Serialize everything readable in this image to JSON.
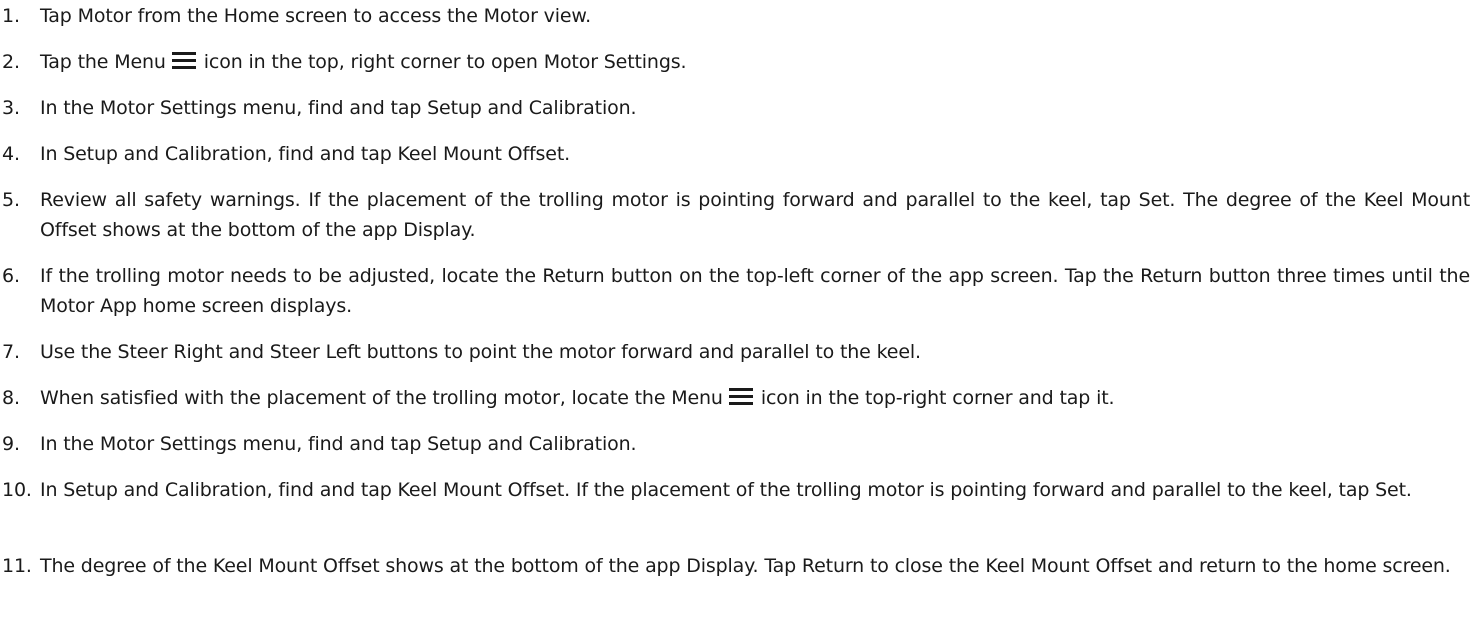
{
  "steps": [
    {
      "number": "1.",
      "text": "Tap Motor from the Home screen to access the Motor view."
    },
    {
      "number": "2.",
      "text_before": "Tap the Menu",
      "icon": "menu-icon",
      "text_after": "icon in the top, right corner to open Motor Settings."
    },
    {
      "number": "3.",
      "text": "In the Motor Settings menu, find and tap Setup and Calibration."
    },
    {
      "number": "4.",
      "text": "In Setup and Calibration, find and tap Keel Mount Offset."
    },
    {
      "number": "5.",
      "text": "Review all safety warnings. If the placement of the trolling motor is pointing forward and parallel to the keel, tap Set. The degree of the Keel Mount Offset shows at the bottom of the app Display."
    },
    {
      "number": "6.",
      "text": "If the trolling motor needs to be adjusted, locate the Return button on the top-left corner of the app screen. Tap the Return button three times until the Motor App home screen displays."
    },
    {
      "number": "7.",
      "text": "Use the Steer Right and Steer Left buttons to point the motor forward and parallel to the keel."
    },
    {
      "number": "8.",
      "text_before": "When satisfied with the placement of the trolling motor, locate the Menu",
      "icon": "menu-icon",
      "text_after": "icon in the top-right corner and tap it."
    },
    {
      "number": "9.",
      "text": "In the Motor Settings menu, find and tap Setup and Calibration."
    },
    {
      "number": "10.",
      "text": "In Setup and Calibration, find and tap Keel Mount Offset. If the placement of the trolling motor is pointing forward and parallel to the keel, tap Set."
    },
    {
      "number": "11.",
      "text": "The degree of the Keel Mount Offset shows at the bottom of the app Display. Tap Return to close the Keel Mount Offset and return to the home screen."
    }
  ]
}
